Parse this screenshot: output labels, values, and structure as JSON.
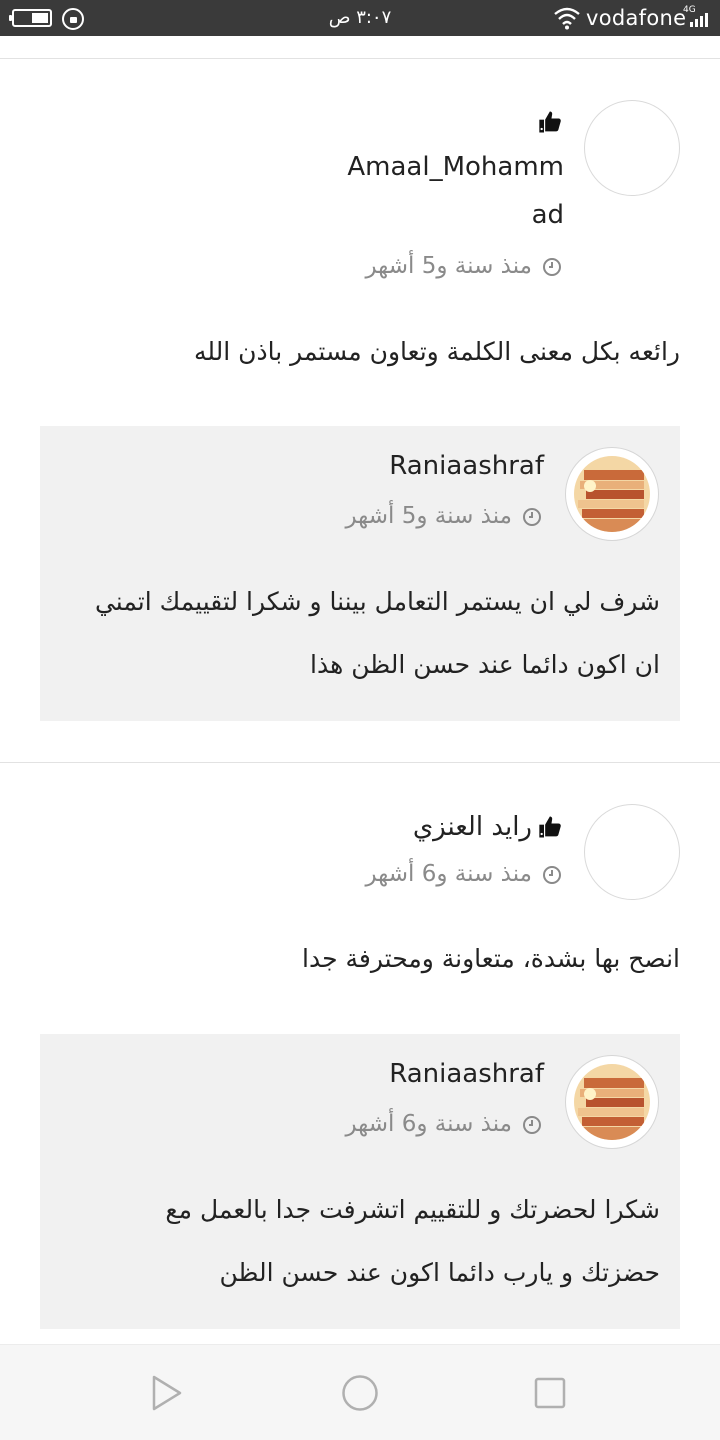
{
  "status_bar": {
    "time": "٣:٠٧ ص",
    "carrier": "vodafone",
    "network": "4G"
  },
  "reviews": [
    {
      "author_line1": "Amaal_Mohamm",
      "author_line2": "ad",
      "time": "منذ سنة و5 أشهر",
      "text": "رائعه بكل معنى الكلمة وتعاون مستمر باذن الله",
      "reply": {
        "author": "Raniaashraf",
        "time": "منذ سنة و5 أشهر",
        "text_line1": "شرف لي ان يستمر التعامل بيننا و شكرا لتقييمك اتمني",
        "text_line2": "ان اكون دائما عند حسن الظن هذا"
      }
    },
    {
      "author": "رايد العنزي",
      "time": "منذ سنة و6 أشهر",
      "text": "انصح بها بشدة، متعاونة ومحترفة جدا",
      "reply": {
        "author": "Raniaashraf",
        "time": "منذ سنة و6 أشهر",
        "text_line1": "شكرا لحضرتك و للتقييم اتشرفت جدا بالعمل مع",
        "text_line2": "حضزتك و يارب دائما اكون عند حسن الظن"
      }
    }
  ],
  "icons": {
    "thumbs_up": "thumbs-up-icon",
    "clock": "clock-icon",
    "back": "triangle-back-icon",
    "home": "circle-home-icon",
    "recents": "square-recents-icon"
  },
  "colors": {
    "status_bar": "#3a3a3a",
    "reply_bg": "#f1f1f1",
    "meta_text": "#8a8a8a"
  }
}
